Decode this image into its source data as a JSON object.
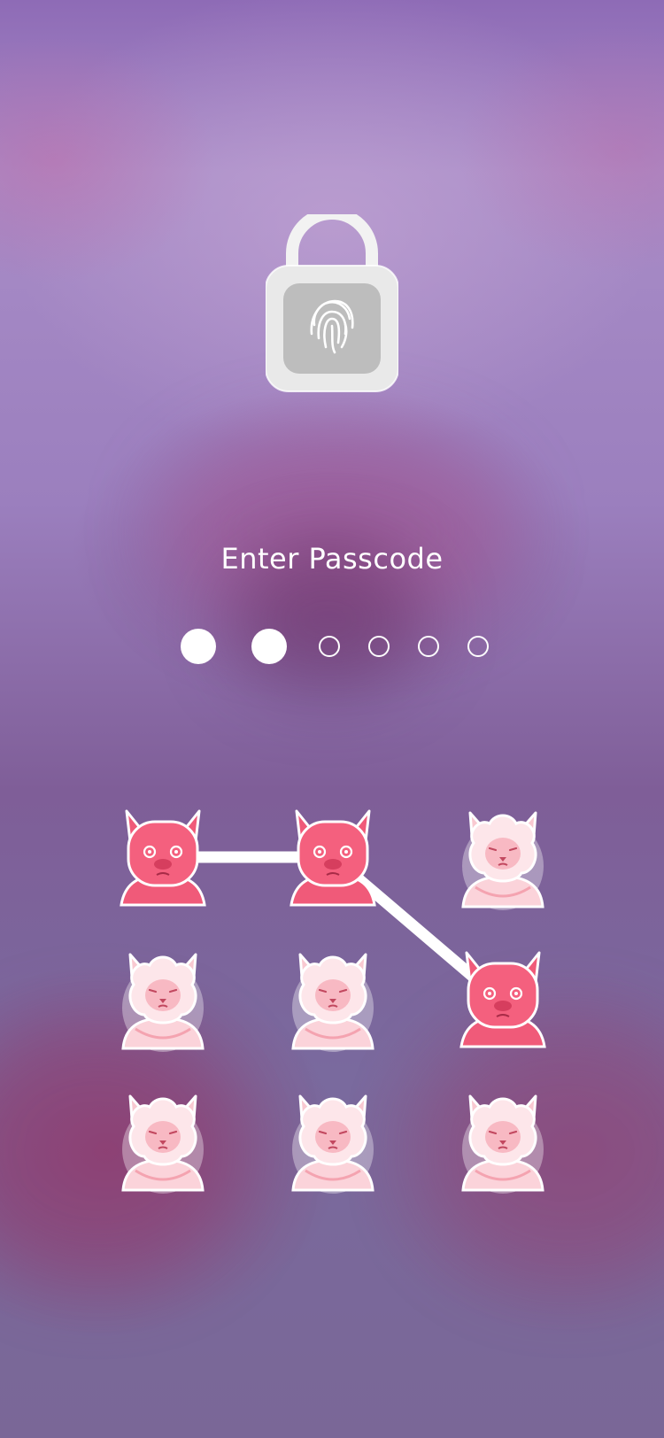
{
  "screen": {
    "title": "Enter Passcode"
  },
  "lock": {
    "icon": "fingerprint-padlock-icon"
  },
  "passcode": {
    "length": 6,
    "entered": 2
  },
  "pattern_grid": {
    "rows": 3,
    "cols": 3,
    "nodes": [
      {
        "icon": "pig-icon",
        "state": "selected"
      },
      {
        "icon": "pig-icon",
        "state": "selected"
      },
      {
        "icon": "sheep-icon",
        "state": "idle"
      },
      {
        "icon": "sheep-icon",
        "state": "idle"
      },
      {
        "icon": "sheep-icon",
        "state": "idle"
      },
      {
        "icon": "pig-icon",
        "state": "selected"
      },
      {
        "icon": "sheep-icon",
        "state": "idle"
      },
      {
        "icon": "sheep-icon",
        "state": "idle"
      },
      {
        "icon": "sheep-icon",
        "state": "idle"
      }
    ],
    "path": [
      0,
      1,
      5
    ]
  },
  "colors": {
    "pig": "#f4607e",
    "pig_dark": "#d63e5e",
    "sheep_wool": "#fde6ea",
    "sheep_face": "#f8b9c3",
    "line": "#ffffff",
    "text": "#ffffff"
  }
}
